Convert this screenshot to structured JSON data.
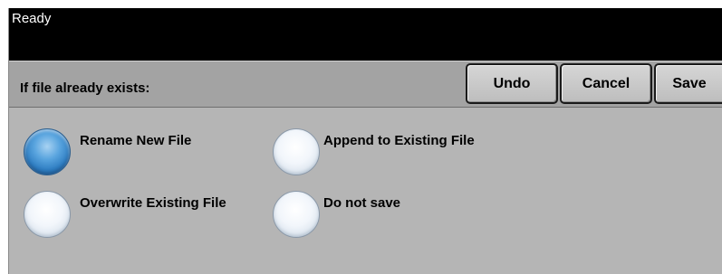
{
  "status": {
    "text": "Ready"
  },
  "header": {
    "title": "If file already exists:",
    "buttons": {
      "undo_label": "Undo",
      "cancel_label": "Cancel",
      "save_label": "Save"
    }
  },
  "options": [
    {
      "label": "Rename New File",
      "selected": true
    },
    {
      "label": "Append to Existing File",
      "selected": false
    },
    {
      "label": "Overwrite Existing File",
      "selected": false
    },
    {
      "label": "Do not save",
      "selected": false
    }
  ],
  "colors": {
    "status_bar": "#000000",
    "panel": "#b5b5b5",
    "header": "#a3a3a3",
    "selected_radio": "#2f7ec2"
  }
}
